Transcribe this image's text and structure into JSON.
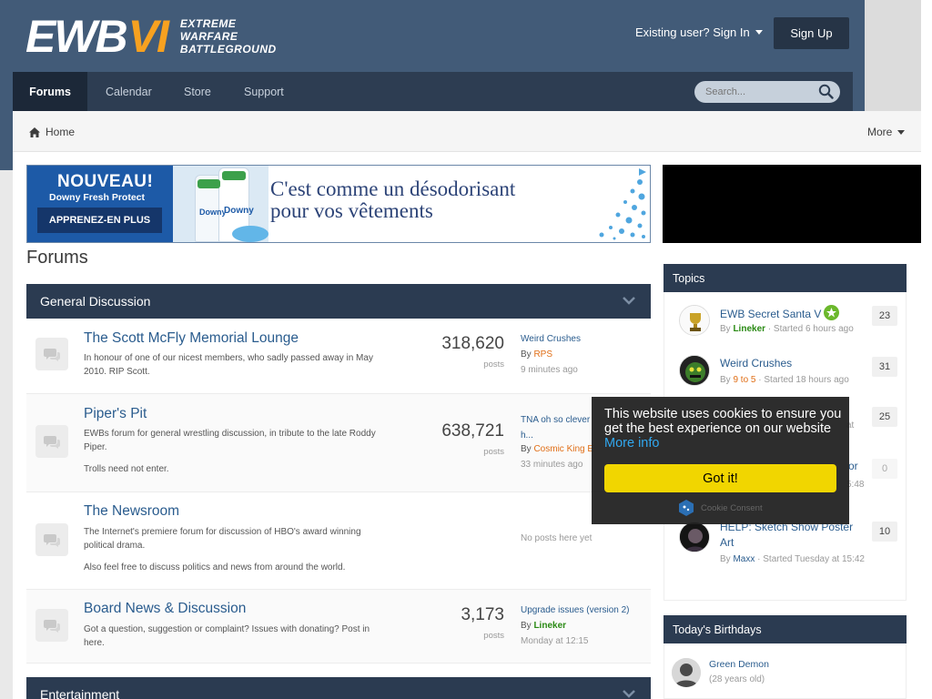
{
  "header": {
    "logo_main": "EWB",
    "logo_accent": "VI",
    "logo_tag": [
      "EXTREME",
      "WARFARE",
      "BATTLEGROUND"
    ],
    "signin_label": "Existing user? Sign In",
    "signup_label": "Sign Up"
  },
  "nav": {
    "tabs": [
      "Forums",
      "Calendar",
      "Store",
      "Support"
    ],
    "search_placeholder": "Search..."
  },
  "breadcrumb": {
    "home": "Home",
    "more": "More"
  },
  "ad": {
    "headline": "NOUVEAU!",
    "subline": "Downy Fresh Protect",
    "button": "APPRENEZ-EN PLUS",
    "tagline_1": "C'est comme un désodorisant",
    "tagline_2": "pour vos vêtements",
    "bottle_label": "Downy"
  },
  "page": {
    "title": "Forums"
  },
  "categories": [
    {
      "name": "General Discussion"
    },
    {
      "name": "Entertainment"
    }
  ],
  "forums": [
    {
      "title": "The Scott McFly Memorial Lounge",
      "desc": "In honour of one of our nicest members, who sadly passed away in May 2010. RIP Scott.",
      "desc2": "",
      "count": "318,620",
      "posts_label": "posts",
      "last_title": "Weird Crushes",
      "last_by_prefix": "By",
      "last_user": "RPS",
      "last_time": "9 minutes ago"
    },
    {
      "title": "Piper's Pit",
      "desc": "EWBs forum for general wrestling discussion, in tribute to the late Roddy Piper.",
      "desc2": "Trolls need not enter.",
      "count": "638,721",
      "posts_label": "posts",
      "last_title": "TNA oh so clever h...",
      "last_by_prefix": "By",
      "last_user": "Cosmic King E",
      "last_time": "33 minutes ago"
    },
    {
      "title": "The Newsroom",
      "desc": "The Internet's premiere forum for discussion of HBO's award winning political drama.",
      "desc2": "Also feel free to discuss politics and news from around the world.",
      "noposts": "No posts here yet"
    },
    {
      "title": "Board News & Discussion",
      "desc": "Got a question, suggestion or complaint? Issues with donating? Post in here.",
      "desc2": "",
      "count": "3,173",
      "posts_label": "posts",
      "last_title": "Upgrade issues (version 2)",
      "last_by_prefix": "By",
      "last_user": "Lineker",
      "last_time": "Monday at 12:15"
    }
  ],
  "sidebar": {
    "topics_title": "Topics",
    "topics": [
      {
        "title": "EWB Secret Santa V",
        "by": "By",
        "user": "Lineker",
        "meta": " · Started 6 hours ago",
        "count": "23"
      },
      {
        "title": "Weird Crushes",
        "by": "By",
        "user": "9 to 5",
        "meta": " · Started 18 hours ago",
        "count": "31"
      },
      {
        "title": "",
        "by": "",
        "user": "",
        "meta": "at",
        "count": "25"
      },
      {
        "title": "or",
        "by": "",
        "user": "",
        "meta": "5:48",
        "count": "0"
      },
      {
        "title": "HELP: Sketch Show Poster Art",
        "by": "By",
        "user": "Maxx",
        "meta": " · Started Tuesday at 15:42",
        "count": "10"
      }
    ],
    "birthdays_title": "Today's Birthdays",
    "birthday_name": "Green Demon",
    "birthday_age": "(28 years old)"
  },
  "cookie": {
    "message": "This website uses cookies to ensure you get the best experience on our website",
    "more": "More info",
    "button": "Got it!",
    "credit": "Cookie Consent"
  },
  "colors": {
    "header_bg": "#425b78",
    "nav_bg": "#2d3d52",
    "accent_orange": "#f7a120",
    "link_blue": "#2a5c8e",
    "cookie_yellow": "#f1d600"
  }
}
